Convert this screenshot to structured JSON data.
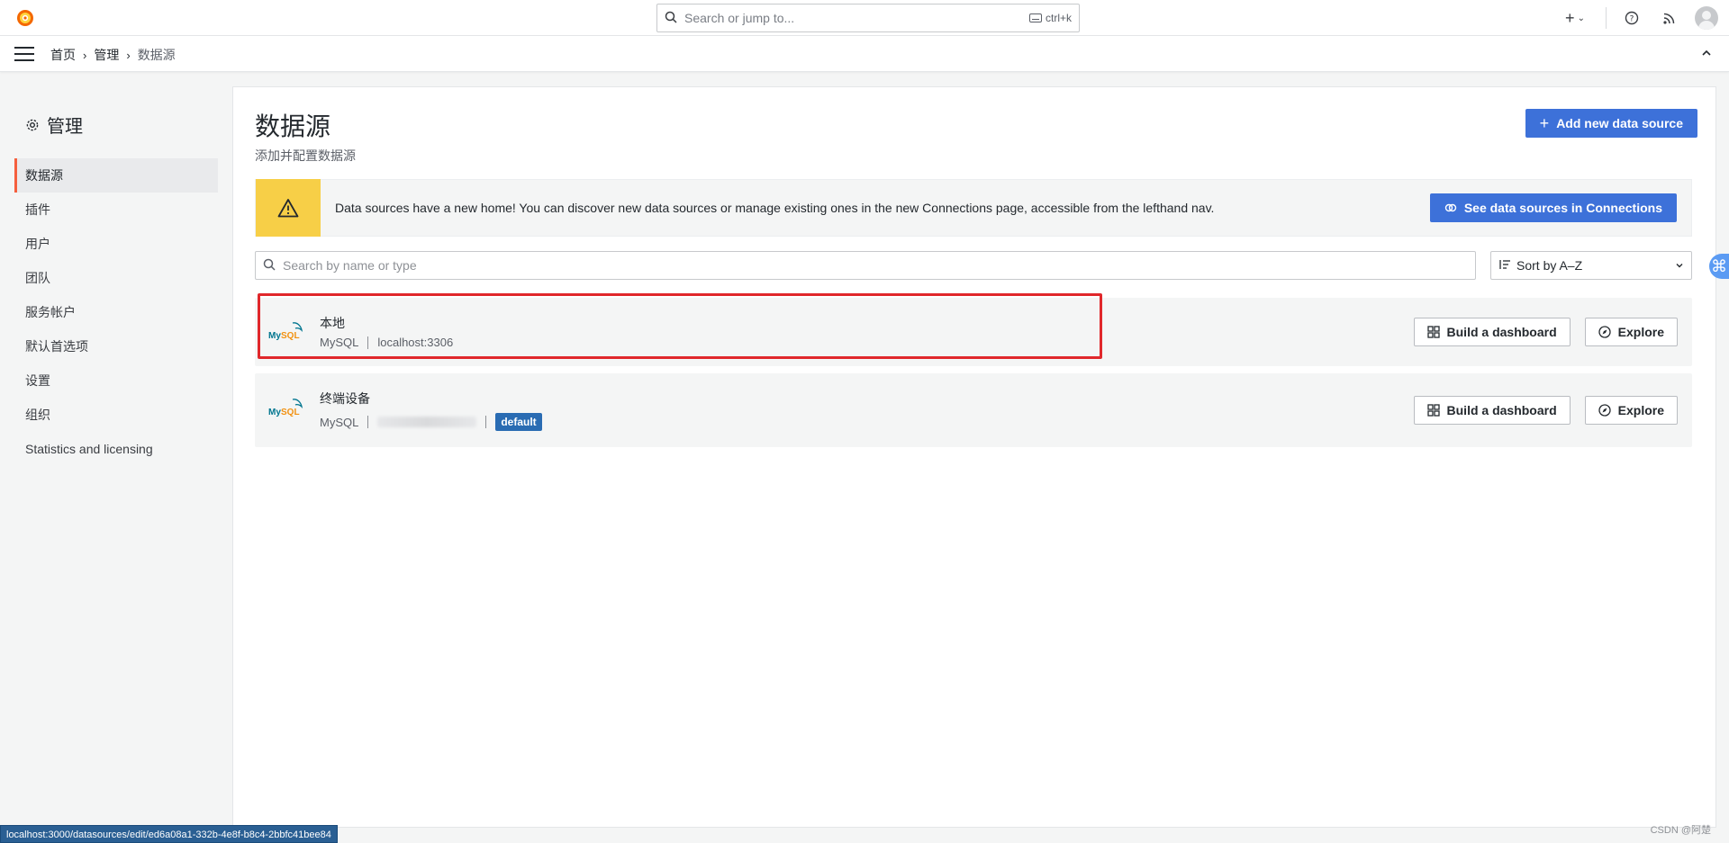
{
  "topbar": {
    "search_placeholder": "Search or jump to...",
    "shortcut": "ctrl+k",
    "icons": [
      "plus-icon",
      "chevron-down-icon",
      "help-icon",
      "rss-icon",
      "user-avatar"
    ]
  },
  "breadcrumb": {
    "items": [
      "首页",
      "管理",
      "数据源"
    ]
  },
  "sidebar": {
    "title": "管理",
    "items": [
      {
        "label": "数据源",
        "active": true
      },
      {
        "label": "插件"
      },
      {
        "label": "用户"
      },
      {
        "label": "团队"
      },
      {
        "label": "服务帐户"
      },
      {
        "label": "默认首选项"
      },
      {
        "label": "设置"
      },
      {
        "label": "组织"
      },
      {
        "label": "Statistics and licensing"
      }
    ]
  },
  "main": {
    "title": "数据源",
    "subtitle": "添加并配置数据源",
    "add_button": "Add new data source",
    "alert": {
      "text": "Data sources have a new home! You can discover new data sources or manage existing ones in the new Connections page, accessible from the lefthand nav.",
      "button": "See data sources in Connections"
    },
    "search_placeholder": "Search by name or type",
    "sort_label": "Sort by A–Z",
    "datasources": [
      {
        "name": "本地",
        "type": "MySQL",
        "url": "localhost:3306",
        "logo_text": "MySQL"
      },
      {
        "name": "终端设备",
        "type": "MySQL",
        "url": "",
        "badge": "default",
        "logo_text": "MySQL"
      }
    ],
    "build_button": "Build a dashboard",
    "explore_button": "Explore"
  },
  "statusbar": {
    "url": "localhost:3000/datasources/edit/ed6a08a1-332b-4e8f-b8c4-2bbfc41bee84"
  },
  "watermark": "CSDN @阿楚",
  "colors": {
    "primary": "#3d71d9",
    "warning": "#f7cf47",
    "active_accent": "#f55f3e",
    "highlight": "#e0272b"
  }
}
